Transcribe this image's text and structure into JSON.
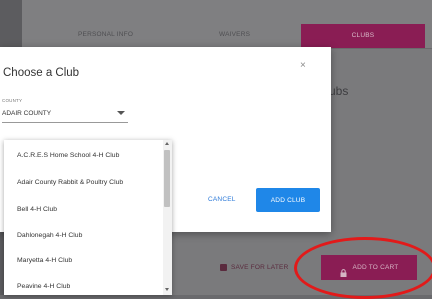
{
  "steps": {
    "personal_info": "PERSONAL INFO",
    "waivers": "WAIVERS",
    "clubs": "CLUBS"
  },
  "background": {
    "title_fragment": "ubs"
  },
  "footer": {
    "save_later": "SAVE FOR LATER",
    "add_to_cart": "ADD TO CART"
  },
  "modal": {
    "title": "Choose a Club",
    "close": "×",
    "county_label": "COUNTY",
    "county_value": "ADAIR COUNTY",
    "cancel": "CANCEL",
    "add_club": "ADD CLUB"
  },
  "dropdown": {
    "items": [
      "A.C.R.E.S Home School 4-H Club",
      "Adair County Rabbit & Poultry Club",
      "Bell 4-H Club",
      "Dahlonegah 4-H Club",
      "Maryetta 4-H Club",
      "Peavine 4-H Club"
    ]
  },
  "colors": {
    "accent": "#8a1d54",
    "primary_button": "#1f87e8",
    "link": "#2a78d8",
    "annotation": "#e21a1a"
  },
  "icons": {
    "save": "floppy-disk-icon",
    "cart": "lock-icon",
    "caret": "caret-down-icon"
  }
}
